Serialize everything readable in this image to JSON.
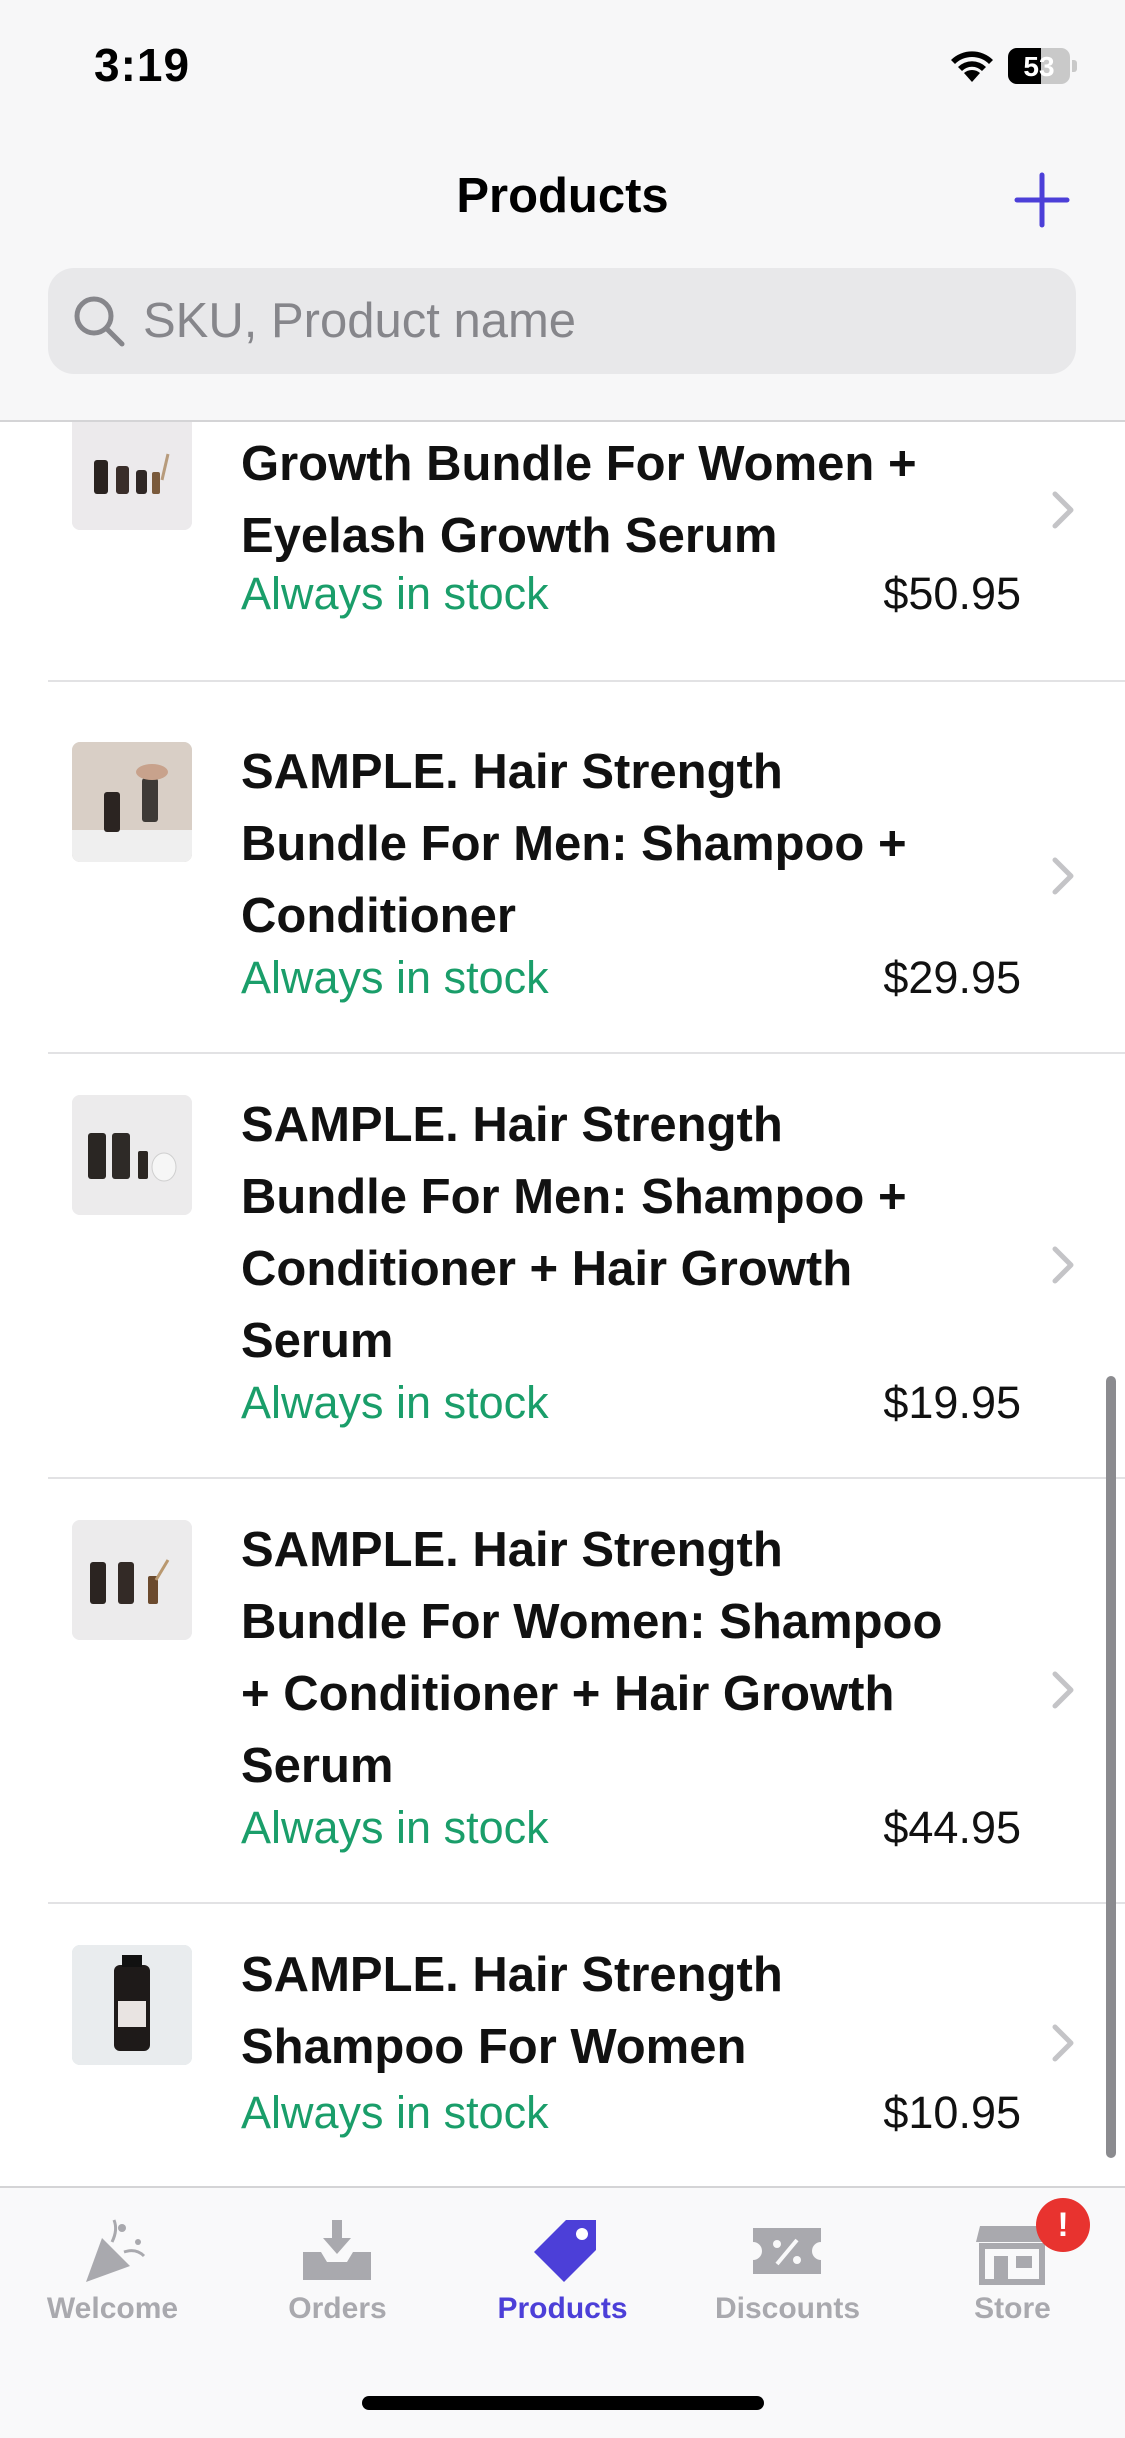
{
  "status_bar": {
    "time": "3:19",
    "battery_level": "53",
    "battery_fraction": 0.53,
    "icons": [
      "wifi-icon",
      "battery-icon"
    ]
  },
  "header": {
    "title": "Products",
    "add_icon": "plus-icon"
  },
  "search": {
    "placeholder": "SKU, Product name",
    "icon": "search-icon"
  },
  "colors": {
    "accent": "#4c3fd8",
    "in_stock": "#1a9e6a",
    "badge": "#e8332f",
    "tab_inactive": "#a9a9ae"
  },
  "products": [
    {
      "name": "SAMPLE. Hair Strength & Growth Bundle For Women + Eyelash Growth Serum",
      "stock": "Always in stock",
      "price": "$50.95"
    },
    {
      "name": "SAMPLE. Hair Strength Bundle For Men: Shampoo + Conditioner",
      "stock": "Always in stock",
      "price": "$29.95"
    },
    {
      "name": "SAMPLE. Hair Strength Bundle For Men: Shampoo + Conditioner + Hair Growth Serum",
      "stock": "Always in stock",
      "price": "$19.95"
    },
    {
      "name": "SAMPLE. Hair Strength Bundle For Women: Shampoo + Conditioner + Hair Growth Serum",
      "stock": "Always in stock",
      "price": "$44.95"
    },
    {
      "name": "SAMPLE. Hair Strength Shampoo For Women",
      "stock": "Always in stock",
      "price": "$10.95"
    }
  ],
  "tabs": [
    {
      "label": "Welcome",
      "icon": "party-popper-icon",
      "active": false
    },
    {
      "label": "Orders",
      "icon": "inbox-download-icon",
      "active": false
    },
    {
      "label": "Products",
      "icon": "tag-icon",
      "active": true
    },
    {
      "label": "Discounts",
      "icon": "discount-ticket-icon",
      "active": false
    },
    {
      "label": "Store",
      "icon": "storefront-icon",
      "active": false,
      "badge": "!"
    }
  ]
}
